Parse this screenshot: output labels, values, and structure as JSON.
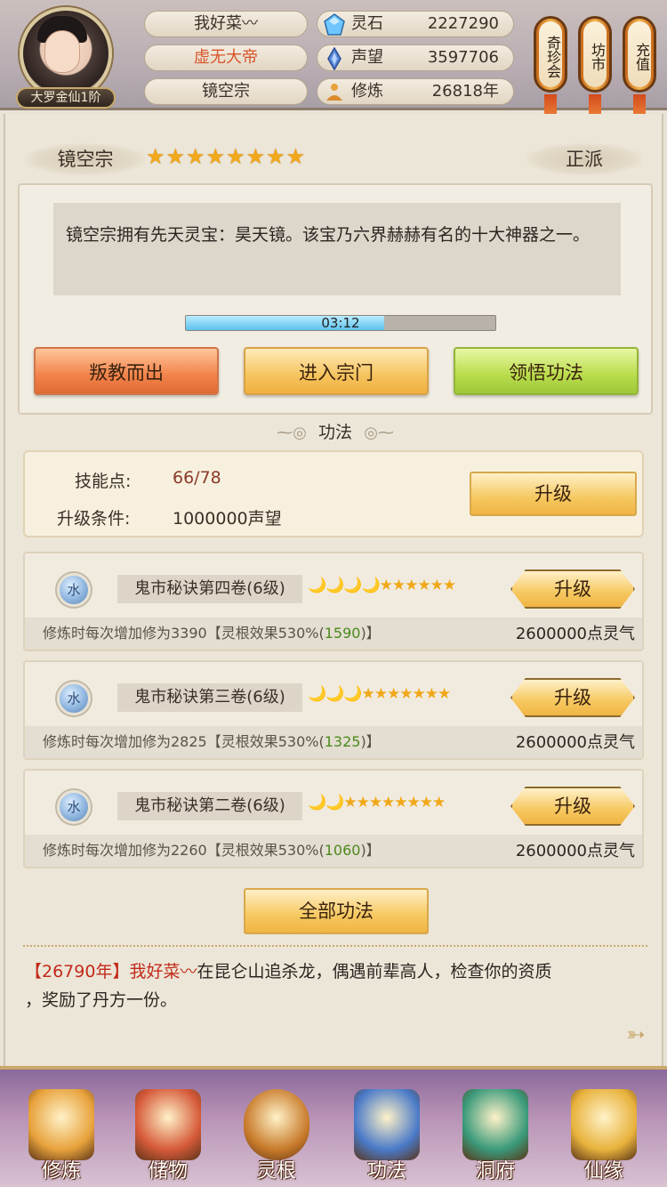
{
  "header": {
    "player_name": "我好菜〰",
    "title": "虚无大帝",
    "sect": "镜空宗",
    "rank_badge": "大罗金仙1阶",
    "resources": [
      {
        "icon": "spirit-stone-icon",
        "label": "灵石",
        "value": "2227290"
      },
      {
        "icon": "prestige-icon",
        "label": "声望",
        "value": "3597706"
      },
      {
        "icon": "cultivation-icon",
        "label": "修炼",
        "value": "26818年"
      }
    ],
    "side_buttons": [
      {
        "label": "奇珍会"
      },
      {
        "label": "坊市"
      },
      {
        "label": "充值"
      }
    ]
  },
  "sect_panel": {
    "name": "镜空宗",
    "star_count": 8,
    "stars": "★★★★★★★★",
    "alignment": "正派",
    "description": "镜空宗拥有先天灵宝：昊天镜。该宝乃六界赫赫有名的十大神器之一。",
    "timer": "03:12",
    "timer_progress": 0.64,
    "buttons": {
      "leave": "叛教而出",
      "enter": "进入宗门",
      "comprehend": "领悟功法"
    }
  },
  "techniques_section": {
    "title": "功法",
    "skill_points_label": "技能点:",
    "skill_points_value": "66/78",
    "upgrade_condition_label": "升级条件:",
    "upgrade_condition_value": "1000000声望",
    "upgrade_button": "升级",
    "items": [
      {
        "element": "水",
        "name": "鬼市秘诀第四卷(6级)",
        "rating": "🌙🌙🌙🌙★★★★★★",
        "desc_prefix": "修炼时每次增加修为3390【灵根效果530%(",
        "desc_green": "1590",
        "desc_suffix": ")】",
        "cost": "2600000点灵气",
        "button": "升级"
      },
      {
        "element": "水",
        "name": "鬼市秘诀第三卷(6级)",
        "rating": "🌙🌙🌙★★★★★★★",
        "desc_prefix": "修炼时每次增加修为2825【灵根效果530%(",
        "desc_green": "1325",
        "desc_suffix": ")】",
        "cost": "2600000点灵气",
        "button": "升级"
      },
      {
        "element": "水",
        "name": "鬼市秘诀第二卷(6级)",
        "rating": "🌙🌙★★★★★★★★",
        "desc_prefix": "修炼时每次增加修为2260【灵根效果530%(",
        "desc_green": "1060",
        "desc_suffix": ")】",
        "cost": "2600000点灵气",
        "button": "升级"
      }
    ],
    "all_button": "全部功法"
  },
  "log": {
    "year": "【26790年】",
    "name": "我好菜〰",
    "text_part1": "在昆仑山追杀龙，偶遇前辈高人，检查你的资质",
    "text_part2": "，奖励了丹方一份。"
  },
  "bottom_nav": [
    {
      "label": "修炼",
      "icon": "monk-meditation-icon",
      "color": "#e8a23c"
    },
    {
      "label": "储物",
      "icon": "treasure-bag-icon",
      "color": "#d65a3a"
    },
    {
      "label": "灵根",
      "icon": "spirit-root-orb-icon",
      "color": "#c87a2a"
    },
    {
      "label": "功法",
      "icon": "scripture-book-icon",
      "color": "#4a7ac8"
    },
    {
      "label": "洞府",
      "icon": "cave-dwelling-icon",
      "color": "#3a9a7a"
    },
    {
      "label": "仙缘",
      "icon": "gourd-icon",
      "color": "#e8b23c"
    }
  ]
}
